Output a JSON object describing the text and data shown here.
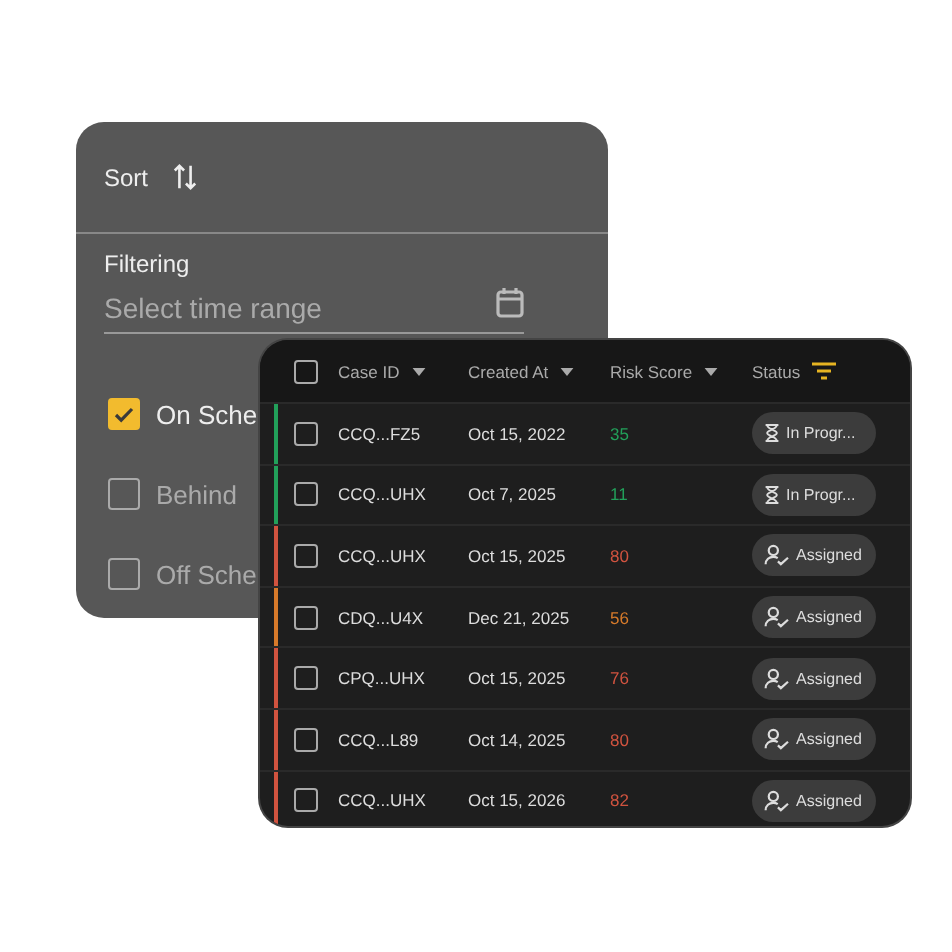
{
  "filter_panel": {
    "sort": {
      "label": "Sort"
    },
    "filtering": {
      "label": "Filtering",
      "placeholder": "Select time range"
    },
    "options": [
      {
        "label": "On Sche",
        "checked": true
      },
      {
        "label": "Behind",
        "checked": false
      },
      {
        "label": "Off Sche",
        "checked": false
      }
    ]
  },
  "table": {
    "select_all": {
      "checked": false
    },
    "columns": [
      {
        "label": "Case ID",
        "kind": "sort"
      },
      {
        "label": "Created At",
        "kind": "sort"
      },
      {
        "label": "Risk Score",
        "kind": "sort"
      },
      {
        "label": "Status",
        "kind": "filter"
      }
    ],
    "rows": [
      {
        "checked": false,
        "color": "#22a05a",
        "case_id": "CCQ...FZ5",
        "created_at": "Oct 15, 2022",
        "risk_score": "35",
        "status": {
          "kind": "in_progress",
          "label": "In Progr..."
        }
      },
      {
        "checked": false,
        "color": "#22a05a",
        "case_id": "CCQ...UHX",
        "created_at": "Oct 7, 2025",
        "risk_score": "11",
        "status": {
          "kind": "in_progress",
          "label": "In Progr..."
        }
      },
      {
        "checked": false,
        "color": "#d0533f",
        "case_id": "CCQ...UHX",
        "created_at": "Oct 15, 2025",
        "risk_score": "80",
        "status": {
          "kind": "assigned",
          "label": "Assigned"
        }
      },
      {
        "checked": false,
        "color": "#d77a2a",
        "case_id": "CDQ...U4X",
        "created_at": "Dec 21, 2025",
        "risk_score": "56",
        "status": {
          "kind": "assigned",
          "label": "Assigned"
        }
      },
      {
        "checked": false,
        "color": "#d0533f",
        "case_id": "CPQ...UHX",
        "created_at": "Oct 15, 2025",
        "risk_score": "76",
        "status": {
          "kind": "assigned",
          "label": "Assigned"
        }
      },
      {
        "checked": false,
        "color": "#d0533f",
        "case_id": "CCQ...L89",
        "created_at": "Oct 14, 2025",
        "risk_score": "80",
        "status": {
          "kind": "assigned",
          "label": "Assigned"
        }
      },
      {
        "checked": false,
        "color": "#d0533f",
        "case_id": "CCQ...UHX",
        "created_at": "Oct 15, 2026",
        "risk_score": "82",
        "status": {
          "kind": "assigned",
          "label": "Assigned"
        }
      }
    ]
  }
}
